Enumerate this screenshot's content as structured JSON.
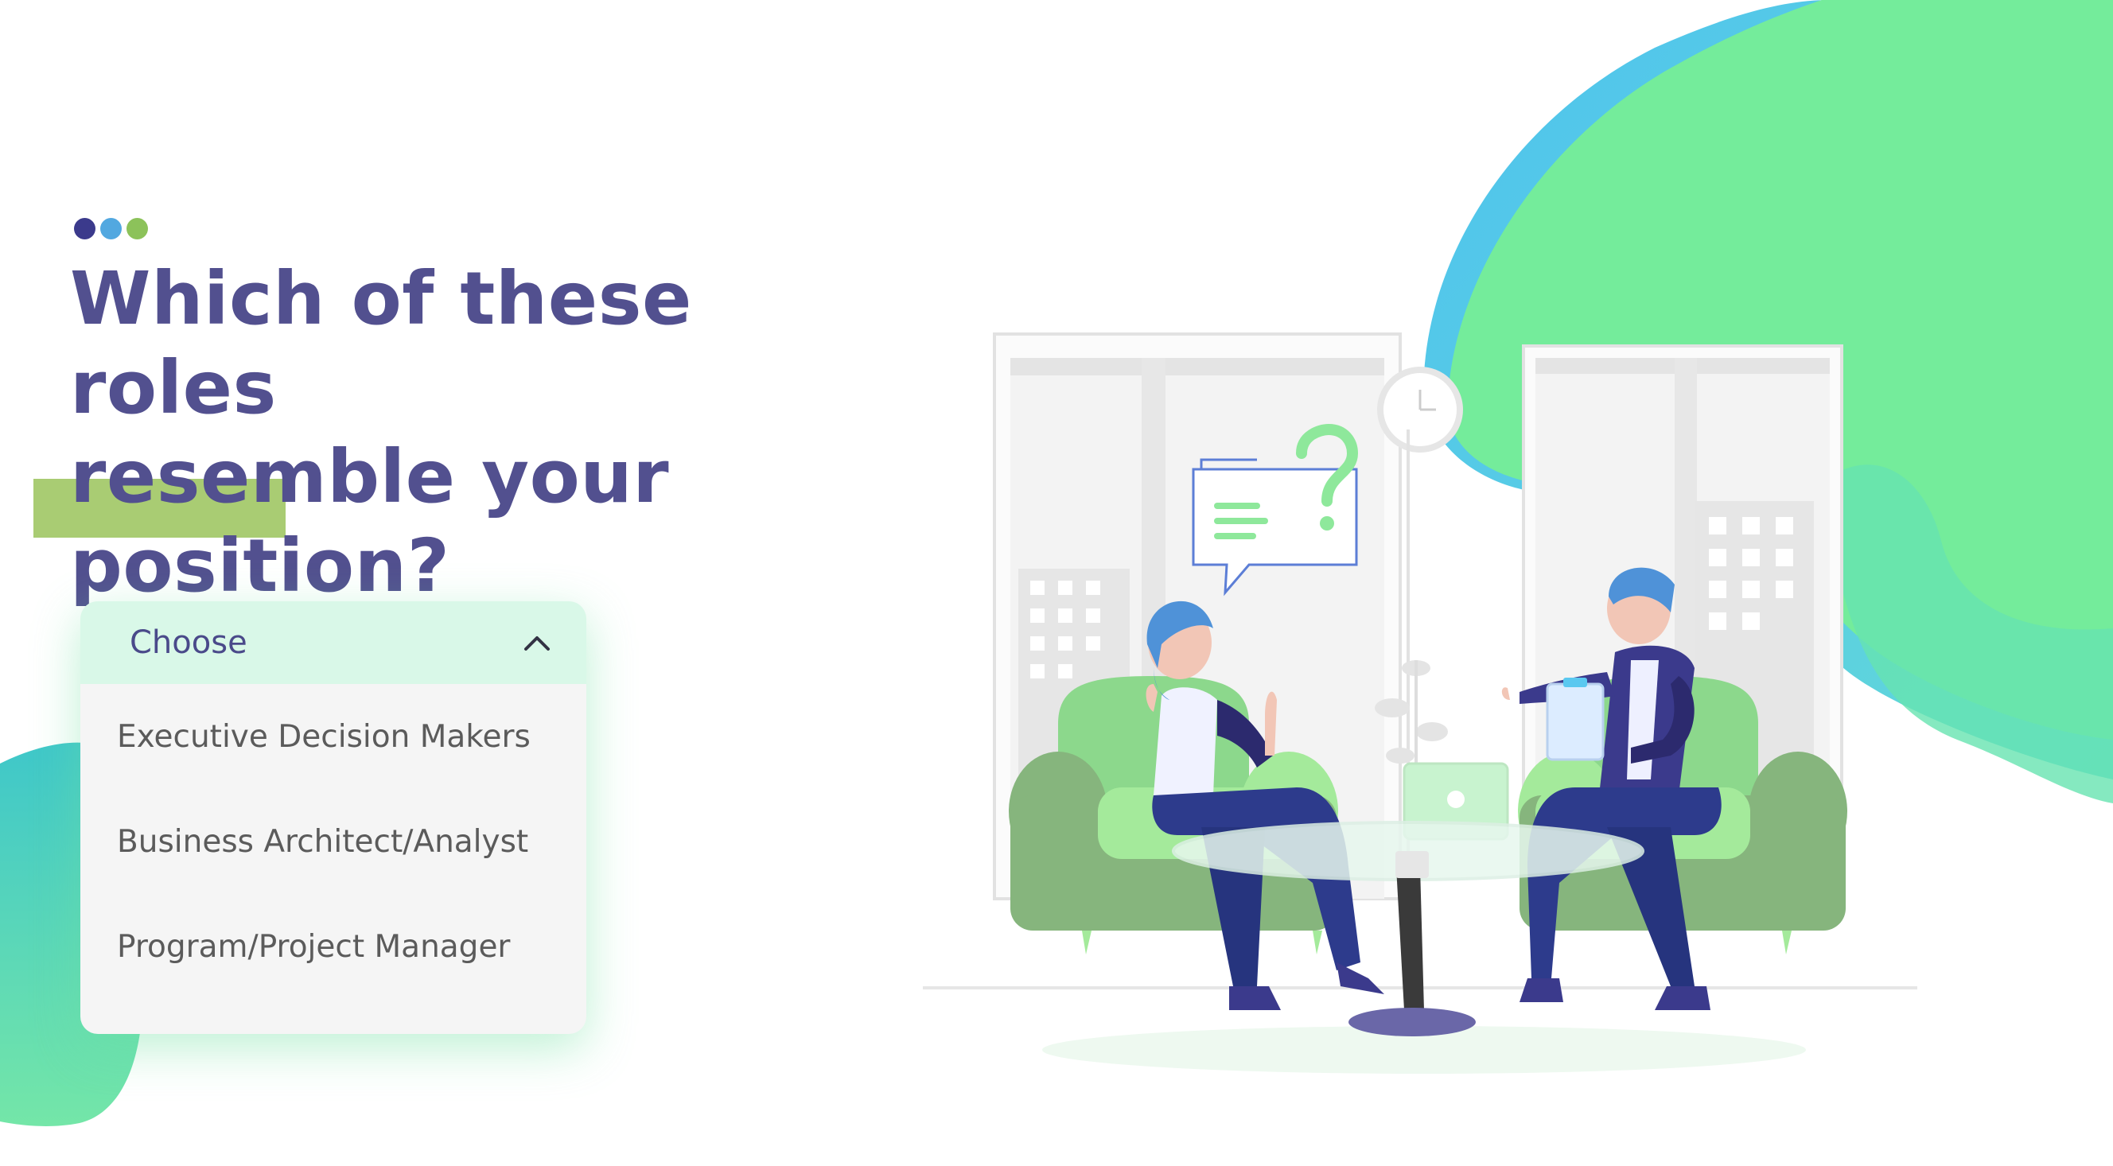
{
  "colors": {
    "heading": "#52508f",
    "highlight": "#a9cc73",
    "dropdown_header_bg": "#d9f8e8",
    "dropdown_text": "#4a4a8a",
    "option_text": "#5b5b5b",
    "blob_green": "#74ec9b",
    "blob_blue": "#5ac8f0",
    "dot_navy": "#3b3a8c",
    "dot_blue": "#52a8e0",
    "dot_green": "#8cc25a"
  },
  "progress": {
    "total_steps": 3
  },
  "question": {
    "line1": "Which of these roles",
    "line2": "resemble your",
    "line3": "position?"
  },
  "dropdown": {
    "selected_label": "Choose",
    "expanded": true,
    "chevron_icon": "chevron-up-icon",
    "options": [
      "Executive Decision Makers",
      "Business Architect/Analyst",
      "Program/Project Manager"
    ]
  },
  "illustration": {
    "icon": "consultation-illustration"
  }
}
